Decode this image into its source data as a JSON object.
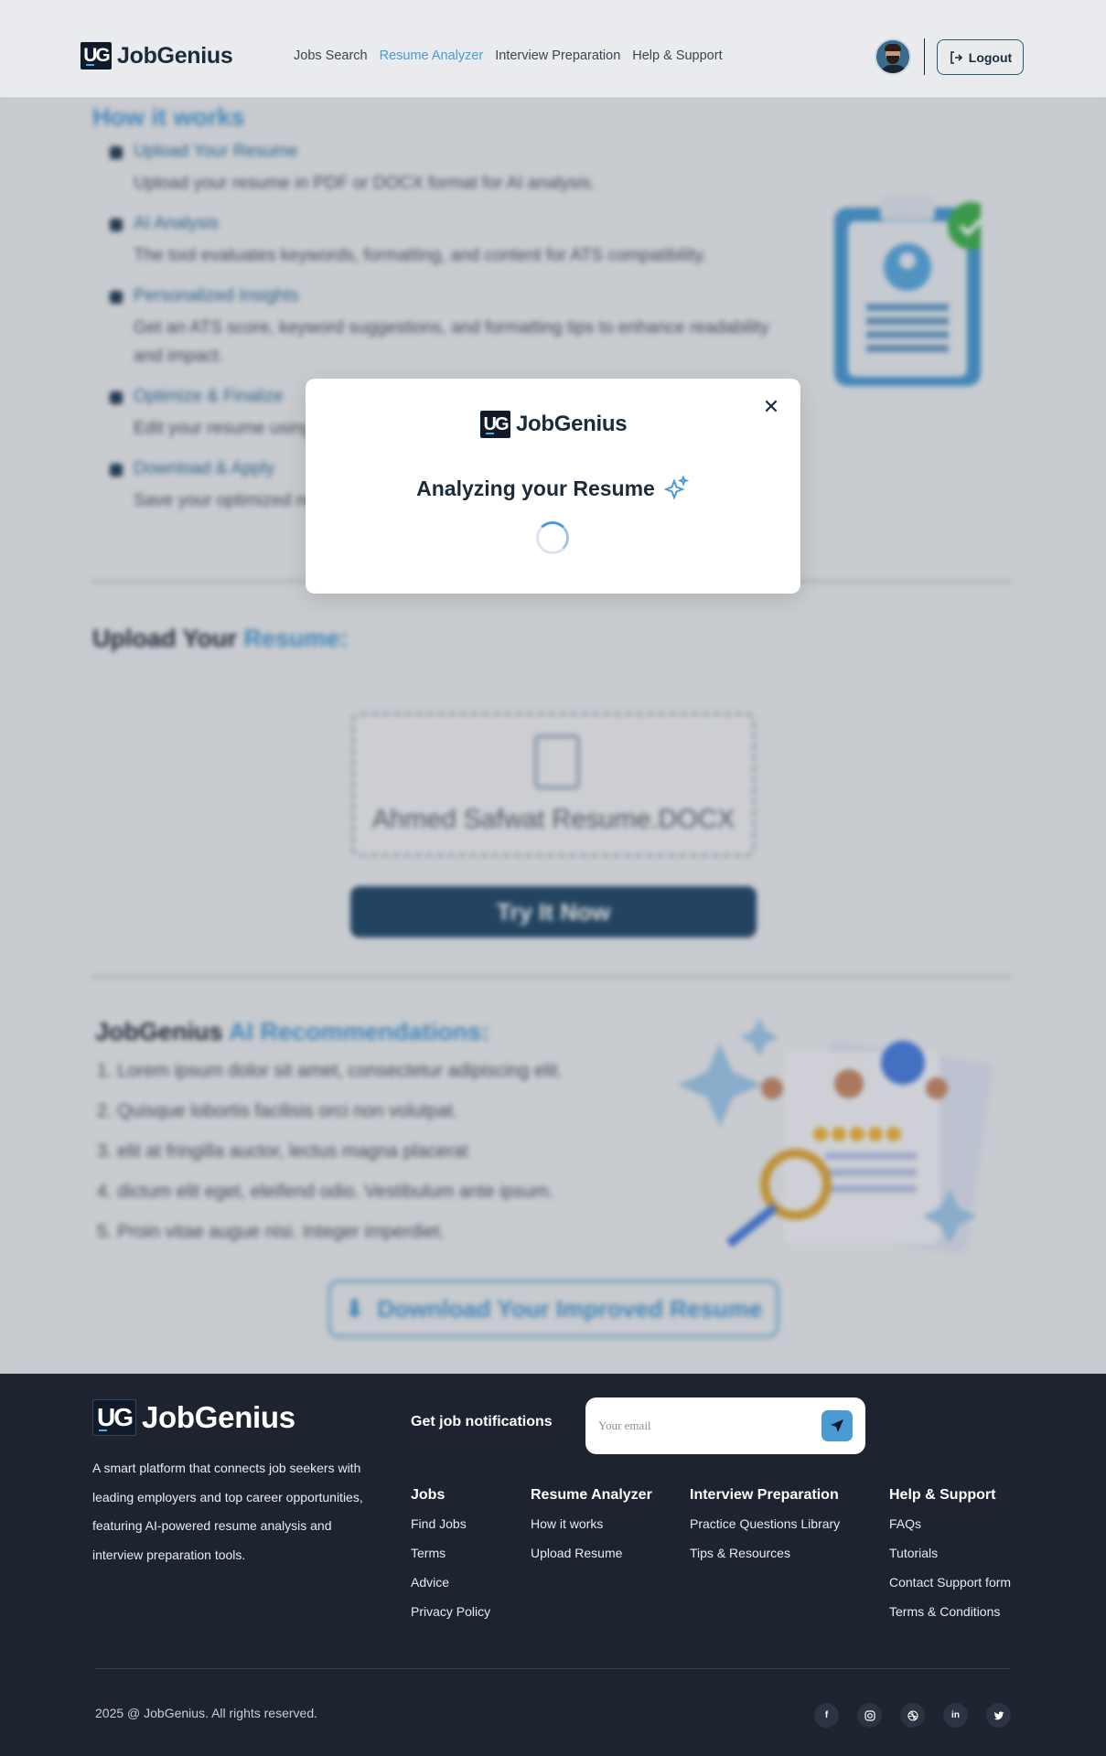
{
  "header": {
    "logo_mark": "UG",
    "logo_text": "JobGenius",
    "nav": [
      "Jobs Search",
      "Resume Analyzer",
      "Interview Preparation",
      "Help & Support"
    ],
    "active_nav": "Resume Analyzer",
    "logout_label": "Logout"
  },
  "background": {
    "how_title_a": "How it works",
    "steps": [
      {
        "title": "Upload Your Resume",
        "desc": "Upload your resume in PDF or DOCX format for AI analysis."
      },
      {
        "title": "AI Analysis",
        "desc": "The tool evaluates keywords, formatting, and content for ATS compatibility."
      },
      {
        "title": "Personalized Insights",
        "desc": "Get an ATS score, keyword suggestions, and formatting tips to enhance readability and impact."
      },
      {
        "title": "Optimize & Finalize",
        "desc": "Edit your resume using AI-driven suggestions and track improvements."
      },
      {
        "title": "Download & Apply",
        "desc": "Save your optimized resume and apply with confidence."
      }
    ],
    "upload_title_a": "Upload Your",
    "upload_title_b": "Resume:",
    "file_name": "Ahmed Safwat Resume.DOCX",
    "try_button": "Try It Now",
    "recs_title_a": "JobGenius",
    "recs_title_b": "AI Recommendations:",
    "recommendations": [
      "1. Lorem ipsum dolor sit amet, consectetur adipiscing elit.",
      "2. Quisque lobortis facilisis orci non volutpat.",
      "3. elit at fringilla auctor, lectus magna placerat",
      "4. dictum elit eget, eleifend odio. Vestibulum ante ipsum.",
      "5. Proin vitae augue nisi. Integer imperdiet."
    ],
    "download_button": "Download Your Improved Resume"
  },
  "modal": {
    "logo_text": "JobGenius",
    "title": "Analyzing your Resume"
  },
  "footer": {
    "logo_text": "JobGenius",
    "tagline": "A smart platform that connects job seekers with leading employers and top career opportunities, featuring AI-powered resume analysis and interview preparation tools.",
    "notify_label": "Get job notifications",
    "email_placeholder": "Your email",
    "columns": [
      {
        "title": "Jobs",
        "links": [
          "Find Jobs",
          "Terms",
          "Advice",
          "Privacy Policy"
        ]
      },
      {
        "title": "Resume Analyzer",
        "links": [
          "How it works",
          "Upload Resume"
        ]
      },
      {
        "title": "Interview Preparation",
        "links": [
          "Practice Questions Library",
          "Tips & Resources"
        ]
      },
      {
        "title": "Help & Support",
        "links": [
          "FAQs",
          "Tutorials",
          "Contact Support form",
          "Terms & Conditions"
        ]
      }
    ],
    "copyright": "2025 @ JobGenius. All rights reserved.",
    "socials": [
      "facebook-icon",
      "instagram-icon",
      "dribbble-icon",
      "linkedin-icon",
      "twitter-icon"
    ]
  },
  "colors": {
    "accent": "#4a9ad3",
    "navy": "#1c2b3a",
    "footer_bg": "#1e2330",
    "button_dark": "#234a6b"
  }
}
